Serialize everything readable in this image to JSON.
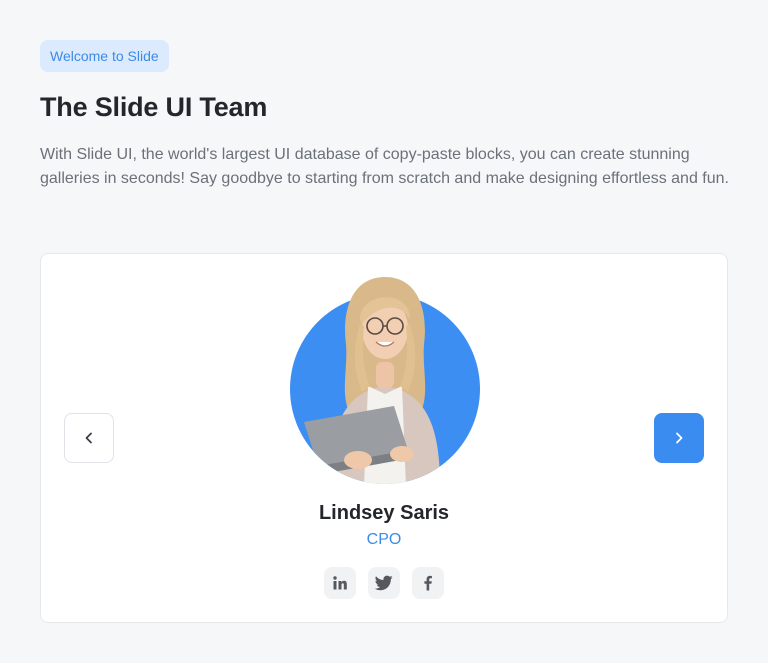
{
  "header": {
    "badge": "Welcome to Slide",
    "title": "The Slide UI Team",
    "description": "With Slide UI, the world's largest UI database of copy-paste blocks, you can create stunning galleries in seconds! Say goodbye to starting from scratch and make designing effortless and fun."
  },
  "carousel": {
    "prev_icon": "chevron-left-icon",
    "next_icon": "chevron-right-icon",
    "member": {
      "name": "Lindsey Saris",
      "role": "CPO"
    },
    "socials": [
      "linkedin-icon",
      "twitter-icon",
      "facebook-icon"
    ]
  },
  "colors": {
    "accent": "#3b8cf0",
    "badge_bg": "#dbeafd",
    "background": "#f6f7f9"
  }
}
